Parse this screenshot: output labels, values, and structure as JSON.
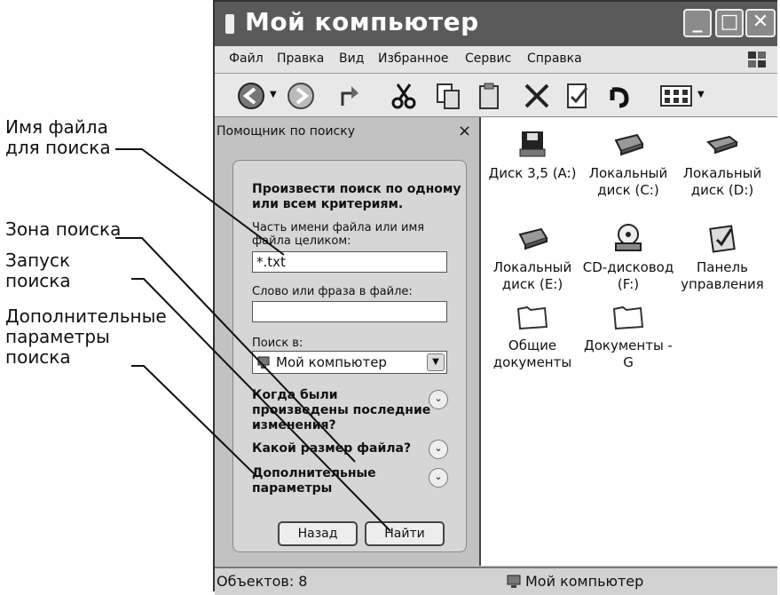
{
  "callouts": {
    "filename": [
      "Имя файла",
      "для поиска"
    ],
    "zone": "Зона поиска",
    "launch": [
      "Запуск",
      "поиска"
    ],
    "extra": [
      "Дополнительные",
      "параметры",
      "поиска"
    ]
  },
  "window": {
    "title": "Мой компьютер",
    "menu": [
      "Файл",
      "Правка",
      "Вид",
      "Избранное",
      "Сервис",
      "Справка"
    ]
  },
  "search_pane": {
    "header": "Помощник по поиску",
    "close": "×",
    "criteria": [
      "Произвести поиск по одному",
      "или всем критериям."
    ],
    "filename_label": [
      "Часть имени файла или имя",
      "файла целиком:"
    ],
    "filename_value": "*.txt",
    "phrase_label": "Слово или фраза в файле:",
    "phrase_value": "",
    "lookin_label": "Поиск в:",
    "lookin_value": "Мой компьютер",
    "when_modified": [
      "Когда были",
      "произведены последние",
      "изменения?"
    ],
    "file_size": "Какой размер файла?",
    "advanced": [
      "Дополнительные",
      "параметры"
    ],
    "back_button": "Назад",
    "find_button": "Найти"
  },
  "items": [
    {
      "l1": "Диск 3,5 (A:)",
      "l2": "",
      "icon": "floppy-drive-icon"
    },
    {
      "l1": "Локальный",
      "l2": "диск (C:)",
      "icon": "hard-drive-icon"
    },
    {
      "l1": "Локальный",
      "l2": "диск (D:)",
      "icon": "hard-drive-icon"
    },
    {
      "l1": "Локальный",
      "l2": "диск (E:)",
      "icon": "hard-drive-icon"
    },
    {
      "l1": "CD-дисковод",
      "l2": "(F:)",
      "icon": "cd-drive-icon"
    },
    {
      "l1": "Панель",
      "l2": "управления",
      "icon": "control-panel-icon"
    },
    {
      "l1": "Общие",
      "l2": "документы",
      "icon": "folder-icon"
    },
    {
      "l1": "Документы -",
      "l2": "G",
      "icon": "folder-icon"
    }
  ],
  "status": {
    "objects": "Объектов: 8",
    "location": "Мой компьютер"
  }
}
